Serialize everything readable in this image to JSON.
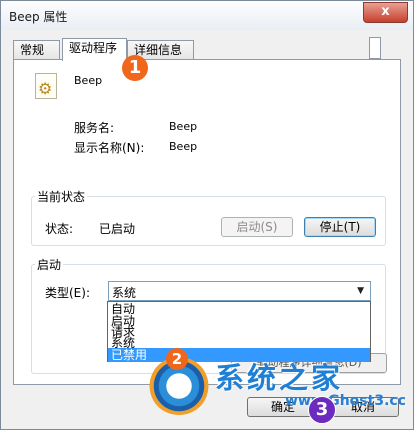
{
  "window": {
    "title": "Beep 属性",
    "close_glyph": "x"
  },
  "tabs": [
    {
      "label": "常规"
    },
    {
      "label": "驱动程序"
    },
    {
      "label": "详细信息"
    }
  ],
  "service": {
    "icon": "gear-service-icon",
    "name": "Beep",
    "fields": [
      {
        "label": "服务名:",
        "value": "Beep"
      },
      {
        "label": "显示名称(N):",
        "value": "Beep"
      }
    ]
  },
  "status_group": {
    "title": "当前状态",
    "status_label": "状态:",
    "status_value": "已启动",
    "start_button": "启动(S)",
    "stop_button": "停止(T)"
  },
  "startup_group": {
    "title": "启动",
    "type_label": "类型(E):",
    "type_value": "系统",
    "options": [
      "自动",
      "启动",
      "请求",
      "系统",
      "已禁用"
    ],
    "selected_option": "已禁用",
    "obscured_button": "驱动程序详细信息(D)"
  },
  "footer": {
    "ok_button": "确定",
    "cancel_button": "取消"
  },
  "callouts": [
    "1",
    "2",
    "3"
  ],
  "watermark": {
    "text": "系统之家",
    "url": "www.Ghost3.cc"
  }
}
